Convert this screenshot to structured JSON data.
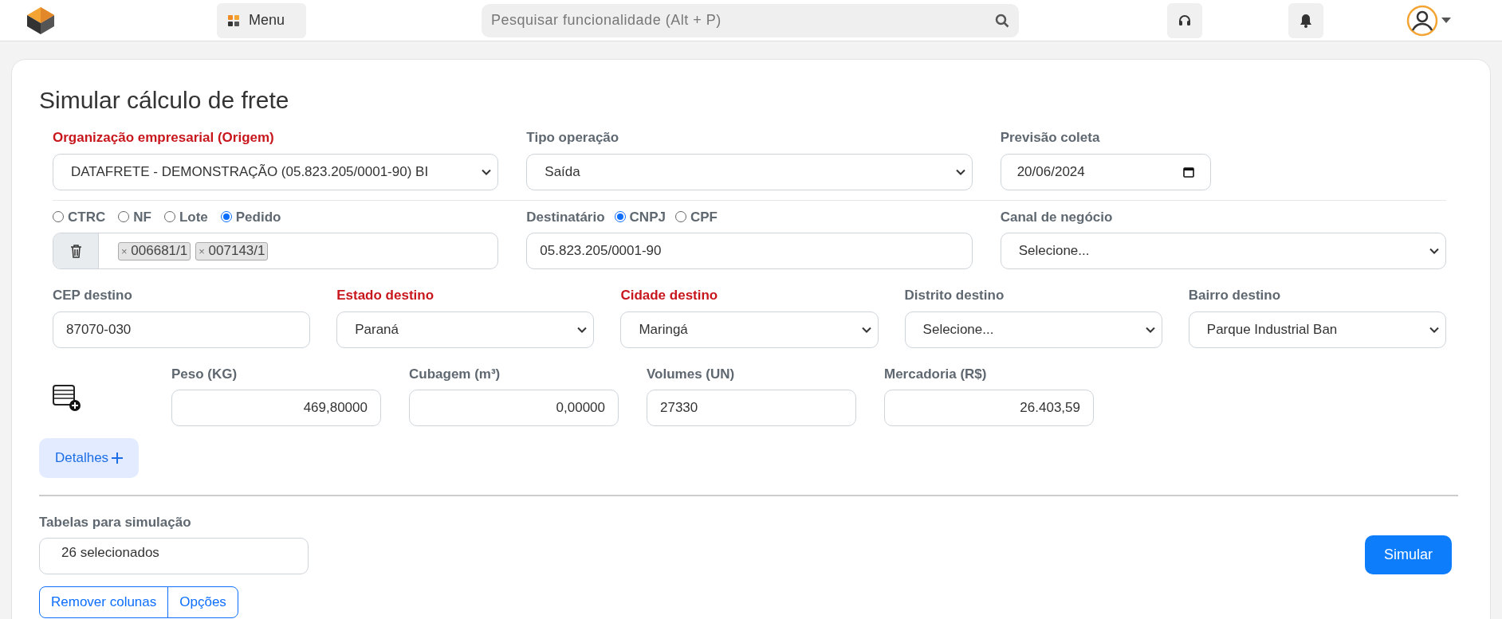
{
  "header": {
    "menu_label": "Menu",
    "search": {
      "placeholder": "Pesquisar funcionalidade (Alt + P)"
    }
  },
  "title": "Simular cálculo de frete",
  "origin": {
    "label": "Organização empresarial (Origem)",
    "required": true,
    "value": "DATAFRETE - DEMONSTRAÇÃO (05.823.205/0001-90) BI"
  },
  "operation": {
    "label": "Tipo operação",
    "required": false,
    "value": "Saída"
  },
  "pickup": {
    "label": "Previsão coleta",
    "required": false,
    "value": "20/06/2024"
  },
  "doc_types": [
    {
      "label": "CTRC",
      "selected": false
    },
    {
      "label": "NF",
      "selected": false
    },
    {
      "label": "Lote",
      "selected": false
    },
    {
      "label": "Pedido",
      "selected": true
    }
  ],
  "doc_tags": [
    {
      "remove": "×",
      "label": "006681/1"
    },
    {
      "remove": "×",
      "label": "007143/1"
    }
  ],
  "recipient": {
    "label": "Destinatário",
    "options": [
      {
        "label": "CNPJ",
        "selected": true
      },
      {
        "label": "CPF",
        "selected": false
      }
    ],
    "value": "05.823.205/0001-90"
  },
  "channel": {
    "label": "Canal de negócio",
    "required": false,
    "value": "Selecione..."
  },
  "destination": [
    {
      "kind": "input",
      "label": "CEP destino",
      "required": false,
      "value": "87070-030"
    },
    {
      "kind": "select",
      "label": "Estado destino",
      "required": true,
      "value": "Paraná"
    },
    {
      "kind": "select",
      "label": "Cidade destino",
      "required": true,
      "value": "Maringá"
    },
    {
      "kind": "select",
      "label": "Distrito destino",
      "required": false,
      "value": "Selecione..."
    },
    {
      "kind": "select",
      "label": "Bairro destino",
      "required": false,
      "value": "Parque Industrial Ban"
    }
  ],
  "cargo": [
    {
      "kind": "decimal",
      "label": "Peso (KG)",
      "value": "469,80000"
    },
    {
      "kind": "decimal",
      "label": "Cubagem (m³)",
      "value": "0,00000"
    },
    {
      "kind": "integer",
      "label": "Volumes (UN)",
      "value": "27330"
    },
    {
      "kind": "decimal",
      "label": "Mercadoria (R$)",
      "value": "26.403,59"
    }
  ],
  "details_button": "Detalhes",
  "tables": {
    "label": "Tabelas para simulação",
    "value": "26 selecionados"
  },
  "simulate_button": "Simular",
  "column_buttons": [
    "Remover colunas",
    "Opções"
  ]
}
